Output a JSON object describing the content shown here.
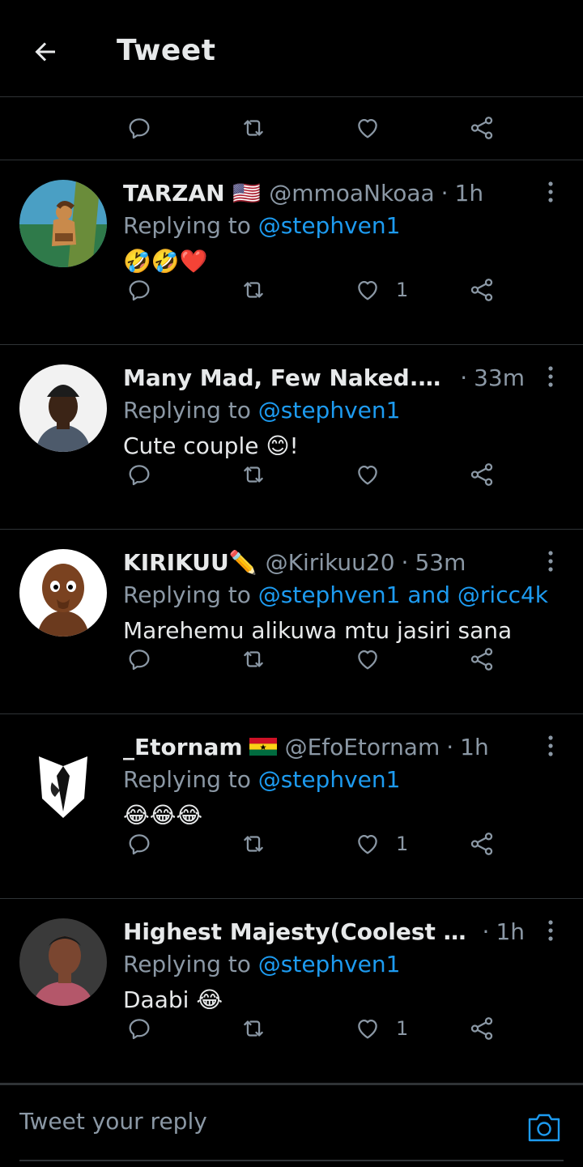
{
  "header": {
    "title": "Tweet"
  },
  "top_actions": {
    "reply_count": "",
    "retweet_count": "",
    "like_count": ""
  },
  "tweets": [
    {
      "name": "TARZAN 🇺🇸",
      "handle": "@mmoaNkoaa",
      "time": "1h",
      "replying_prefix": "Replying to ",
      "replying_to": "@stephven1",
      "text": "🤣🤣❤️",
      "like_count": "1"
    },
    {
      "name": "Many Mad, Few Naked.😉 ...",
      "handle": "",
      "time": "33m",
      "replying_prefix": "Replying to ",
      "replying_to": "@stephven1",
      "text": "Cute couple 😊!",
      "like_count": ""
    },
    {
      "name": "KIRIKUU✏️",
      "handle": "@Kirikuu20",
      "time": "53m",
      "replying_prefix": "Replying to ",
      "replying_to": "@stephven1 and @ricc4k",
      "text": "Marehemu alikuwa mtu jasiri sana",
      "like_count": ""
    },
    {
      "name": "_Etornam",
      "handle": "@EfoEtornam",
      "time": "1h",
      "replying_prefix": "Replying to ",
      "replying_to": "@stephven1",
      "text": "😂😂😂",
      "like_count": "1"
    },
    {
      "name": "Highest Majesty(Coolest Boy...",
      "handle": "",
      "time": "1h",
      "replying_prefix": "Replying to ",
      "replying_to": "@stephven1",
      "text": "Daabi 😂",
      "like_count": "1"
    }
  ],
  "reply_bar": {
    "placeholder": "Tweet your reply"
  },
  "colors": {
    "background": "#000000",
    "accent": "#1d9bf0",
    "muted": "#8b98a5",
    "divider": "#2f3336"
  },
  "icons": [
    "back-arrow-icon",
    "reply-icon",
    "retweet-icon",
    "heart-icon",
    "share-icon",
    "more-icon",
    "camera-icon"
  ]
}
